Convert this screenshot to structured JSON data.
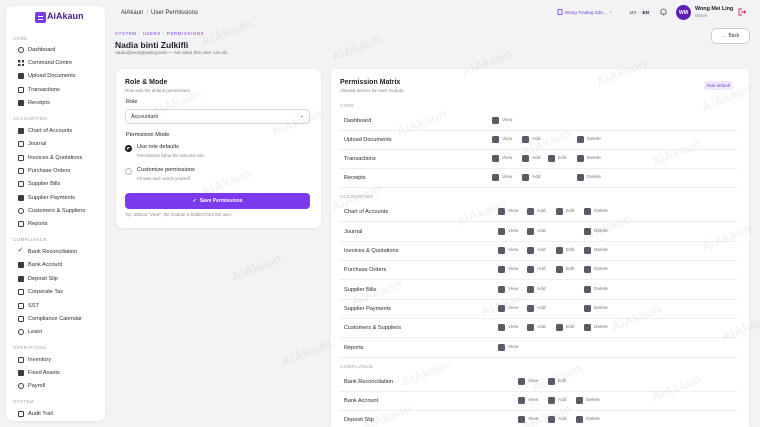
{
  "brand": {
    "name": "AiAkaun"
  },
  "sidebar": {
    "sections": [
      {
        "label": "CORE",
        "items": [
          {
            "label": "Dashboard",
            "icon": "dashboard-icon"
          },
          {
            "label": "Command Centre",
            "icon": "grid-icon"
          },
          {
            "label": "Upload Documents",
            "icon": "upload-icon"
          },
          {
            "label": "Transactions",
            "icon": "transactions-icon"
          },
          {
            "label": "Receipts",
            "icon": "receipt-icon"
          }
        ]
      },
      {
        "label": "ACCOUNTING",
        "items": [
          {
            "label": "Chart of Accounts",
            "icon": "chart-icon"
          },
          {
            "label": "Journal",
            "icon": "journal-icon"
          },
          {
            "label": "Invoices & Quotations",
            "icon": "invoice-icon"
          },
          {
            "label": "Purchase Orders",
            "icon": "purchase-icon"
          },
          {
            "label": "Supplier Bills",
            "icon": "bill-icon"
          },
          {
            "label": "Supplier Payments",
            "icon": "payment-icon"
          },
          {
            "label": "Customers & Suppliers",
            "icon": "people-icon"
          },
          {
            "label": "Reports",
            "icon": "reports-icon"
          }
        ]
      },
      {
        "label": "COMPLIANCE",
        "items": [
          {
            "label": "Bank Reconciliation",
            "icon": "check-icon"
          },
          {
            "label": "Bank Account",
            "icon": "bank-icon"
          },
          {
            "label": "Deposit Slip",
            "icon": "deposit-icon"
          },
          {
            "label": "Corporate Tax",
            "icon": "tax-icon"
          },
          {
            "label": "SST",
            "icon": "sst-icon"
          },
          {
            "label": "Compliance Calendar",
            "icon": "calendar-icon"
          },
          {
            "label": "Learn",
            "icon": "learn-icon"
          }
        ]
      },
      {
        "label": "OPERATIONS",
        "items": [
          {
            "label": "Inventory",
            "icon": "inventory-icon"
          },
          {
            "label": "Fixed Assets",
            "icon": "assets-icon"
          },
          {
            "label": "Payroll",
            "icon": "payroll-icon"
          }
        ]
      },
      {
        "label": "SYSTEM",
        "items": [
          {
            "label": "Audit Trail",
            "icon": "audit-icon"
          }
        ]
      }
    ]
  },
  "topbar": {
    "crumb_root": "AiAkaun",
    "crumb_sep": "/",
    "crumb_current": "User Permissions",
    "company": "Wong Trading Sdn...",
    "lang_ms": "MS",
    "lang_en": "EN",
    "user_initials": "WM",
    "user_name": "Wong Mei Ling",
    "user_role": "Owner"
  },
  "header": {
    "crumb_1": "SYSTEM",
    "crumb_2": "USERS",
    "crumb_3": "PERMISSIONS",
    "title": "Nadia binti Zulkifli",
    "subtitle": "nadia@wongtrading.test — set what this user can do.",
    "back_label": "Back"
  },
  "role_card": {
    "title": "Role & Mode",
    "subtitle": "Role sets the default permissions.",
    "role_label": "Role",
    "role_value": "Accountant",
    "mode_label": "Permission Mode",
    "opt1_title": "Use role defaults",
    "opt1_desc": "Permissions follow the selected role.",
    "opt2_title": "Customize permissions",
    "opt2_desc": "Choose each action yourself.",
    "save_label": "Save Permissions",
    "tip": "Tip: without \"View\", the module is hidden from the user."
  },
  "matrix": {
    "title": "Permission Matrix",
    "subtitle": "Allowed actions for each module.",
    "badge": "Role default",
    "sections": [
      {
        "label": "CORE",
        "rows": [
          {
            "name": "Dashboard",
            "perms": [
              "View"
            ]
          },
          {
            "name": "Upload Documents",
            "perms": [
              "View",
              "Add",
              "Delete"
            ]
          },
          {
            "name": "Transactions",
            "perms": [
              "View",
              "Add",
              "Edit",
              "Delete"
            ]
          },
          {
            "name": "Receipts",
            "perms": [
              "View",
              "Add",
              "Delete"
            ]
          }
        ]
      },
      {
        "label": "ACCOUNTING",
        "rows": [
          {
            "name": "Chart of Accounts",
            "perms": [
              "View",
              "Add",
              "Edit",
              "Delete"
            ]
          },
          {
            "name": "Journal",
            "perms": [
              "View",
              "Add",
              "Delete"
            ]
          },
          {
            "name": "Invoices & Quotations",
            "perms": [
              "View",
              "Add",
              "Edit",
              "Delete"
            ]
          },
          {
            "name": "Purchase Orders",
            "perms": [
              "View",
              "Add",
              "Edit",
              "Delete"
            ]
          },
          {
            "name": "Supplier Bills",
            "perms": [
              "View",
              "Add",
              "Delete"
            ]
          },
          {
            "name": "Supplier Payments",
            "perms": [
              "View",
              "Add",
              "Delete"
            ]
          },
          {
            "name": "Customers & Suppliers",
            "perms": [
              "View",
              "Add",
              "Edit",
              "Delete"
            ]
          },
          {
            "name": "Reports",
            "perms": [
              "View"
            ]
          }
        ]
      },
      {
        "label": "COMPLIANCE",
        "rows": [
          {
            "name": "Bank Reconciliation",
            "perms": [
              "View",
              "Edit"
            ]
          },
          {
            "name": "Bank Account",
            "perms": [
              "View",
              "Add",
              "Delete"
            ]
          },
          {
            "name": "Deposit Slip",
            "perms": [
              "View",
              "Add",
              "Delete"
            ]
          }
        ]
      }
    ]
  },
  "watermark": "AiAkaun",
  "colors": {
    "accent": "#7c3aed",
    "brand_dark": "#4c1d95",
    "checkbox": "#5a5a66"
  }
}
